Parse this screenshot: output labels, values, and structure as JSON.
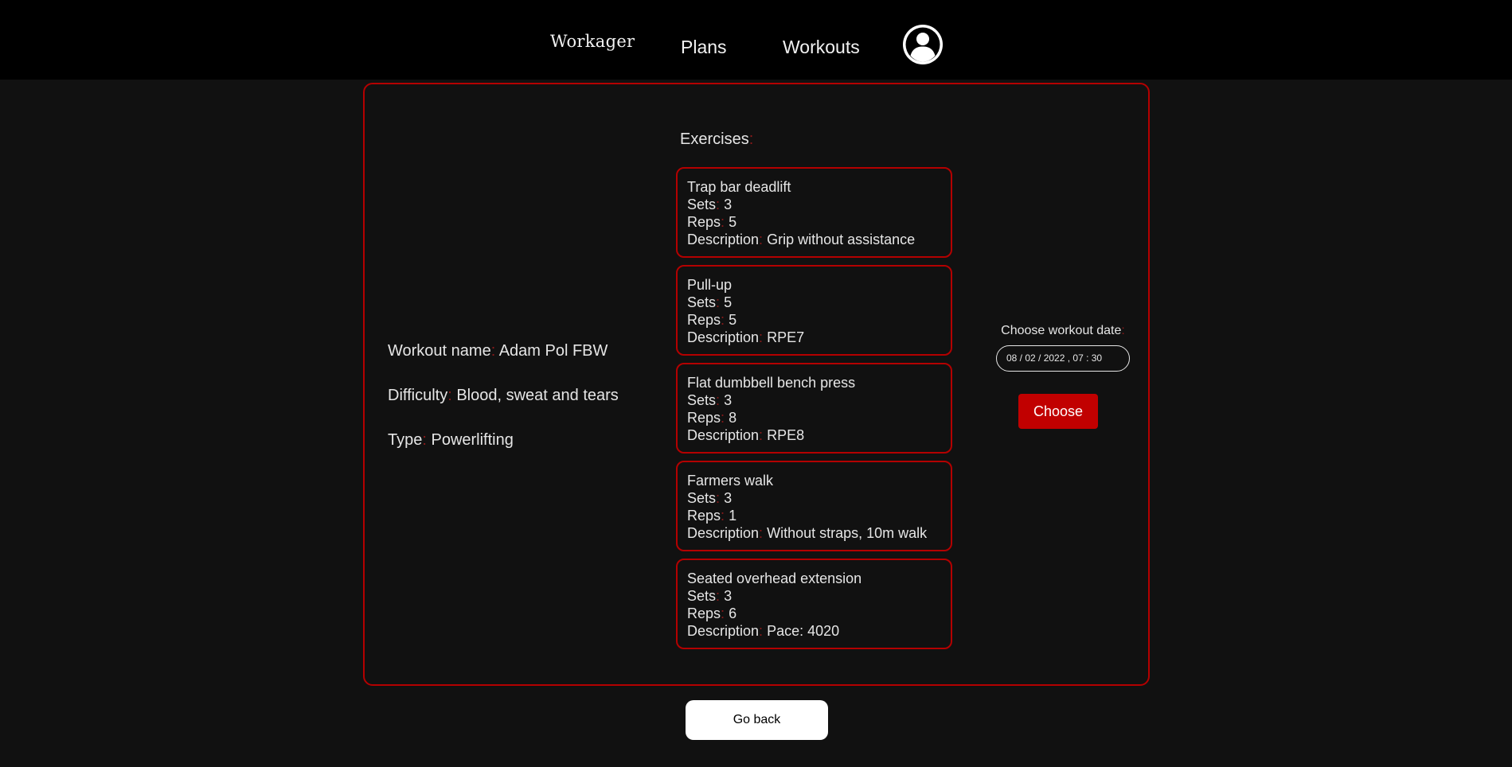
{
  "nav": {
    "logo": "Workager",
    "plans": "Plans",
    "workouts": "Workouts",
    "profile_icon": "user-circle-icon"
  },
  "workout": {
    "name_label": "Workout name",
    "name": "Adam Pol FBW",
    "difficulty_label": "Difficulty",
    "difficulty": "Blood, sweat and tears",
    "type_label": "Type",
    "type": "Powerlifting"
  },
  "exercises_heading": "Exercises",
  "field_labels": {
    "sets": "Sets",
    "reps": "Reps",
    "description": "Description"
  },
  "exercises": [
    {
      "name": "Trap bar deadlift",
      "sets": "3",
      "reps": "5",
      "description": "Grip without assistance"
    },
    {
      "name": "Pull-up",
      "sets": "5",
      "reps": "5",
      "description": "RPE7"
    },
    {
      "name": "Flat dumbbell bench press",
      "sets": "3",
      "reps": "8",
      "description": "RPE8"
    },
    {
      "name": "Farmers walk",
      "sets": "3",
      "reps": "1",
      "description": "Without straps, 10m walk"
    },
    {
      "name": "Seated overhead extension",
      "sets": "3",
      "reps": "6",
      "description": "Pace: 4020"
    }
  ],
  "date_picker": {
    "label": "Choose workout date",
    "value": "08 / 02 / 2022 ,  07 : 30",
    "button": "Choose"
  },
  "go_back": "Go back",
  "colors": {
    "background": "#111111",
    "topbar": "#000000",
    "accent": "#b40000",
    "button": "#c10000"
  }
}
